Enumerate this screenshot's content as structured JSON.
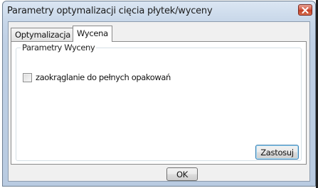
{
  "window": {
    "title": "Parametry optymalizacji cięcia płytek/wyceny"
  },
  "tabs": [
    {
      "label": "Optymalizacja",
      "active": false
    },
    {
      "label": "Wycena",
      "active": true
    }
  ],
  "group": {
    "legend": "Parametry Wyceny",
    "checkbox": {
      "label": "zaokrąglanie do pełnych opakowań",
      "checked": false
    }
  },
  "buttons": {
    "apply_label": "Zastosuj",
    "ok_label": "OK"
  },
  "icons": {
    "close": "close-icon"
  },
  "colors": {
    "title_bar": "#c8d7e9",
    "close_button": "#c94a31"
  }
}
